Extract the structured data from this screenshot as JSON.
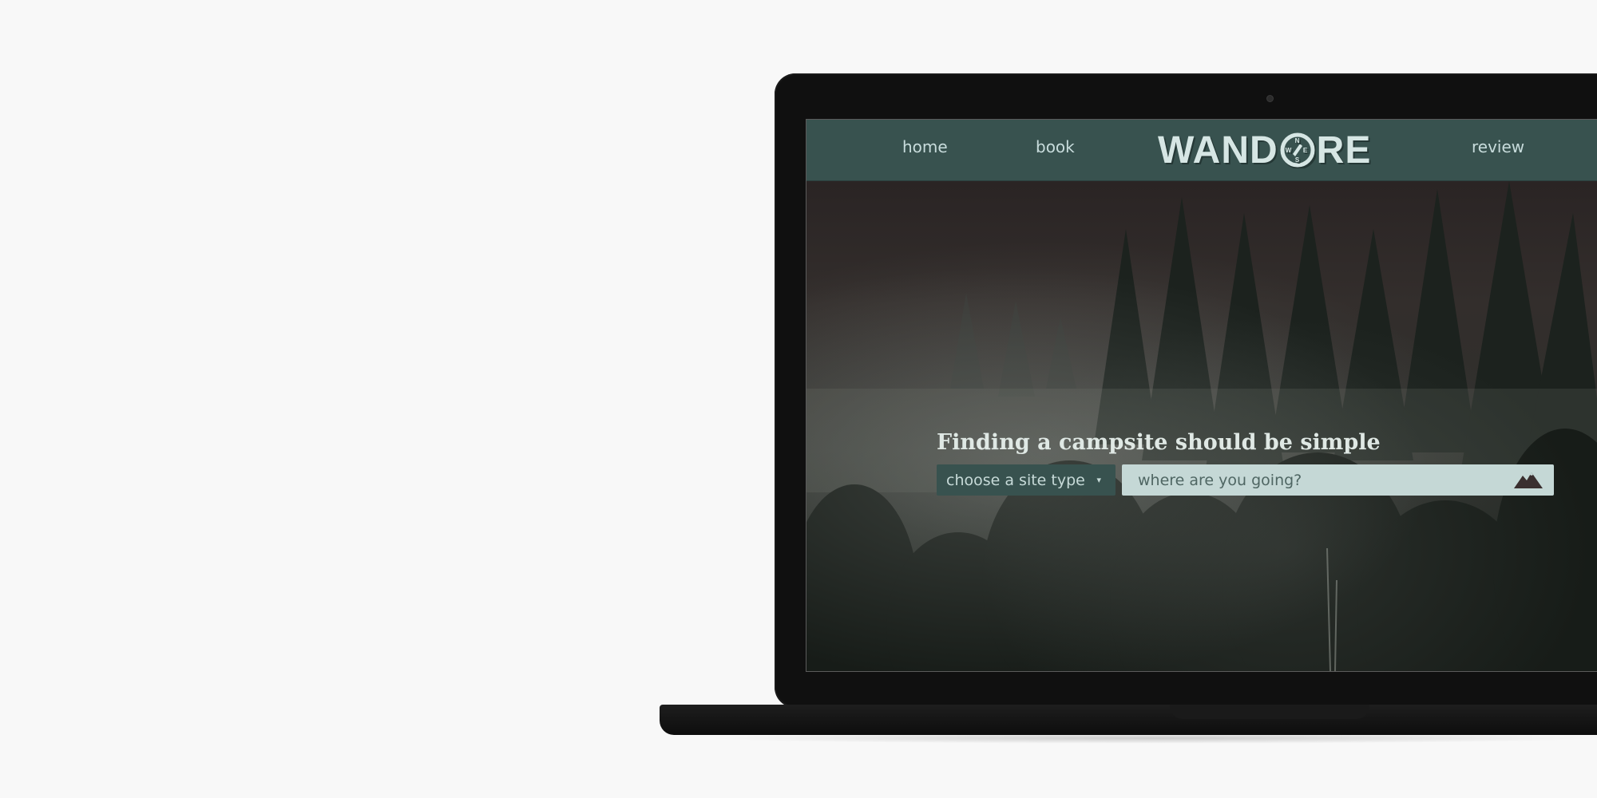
{
  "nav": {
    "home": "home",
    "book": "book",
    "review": "review",
    "logo_left": "WAND",
    "logo_right": "RE",
    "compass": {
      "n": "N",
      "e": "E",
      "s": "S",
      "w": "W"
    }
  },
  "hero": {
    "headline": "Finding a campsite should be simple",
    "site_type_label": "choose a site type",
    "site_type_caret": "▾",
    "search_placeholder": "where are you going?"
  },
  "icons": {
    "compass": "compass-icon",
    "mountain": "mountain-icon",
    "caret": "caret-down-icon"
  },
  "colors": {
    "nav_bg": "#38524f",
    "accent_light": "#c5d8d6",
    "text_light": "#d6e6e4"
  }
}
